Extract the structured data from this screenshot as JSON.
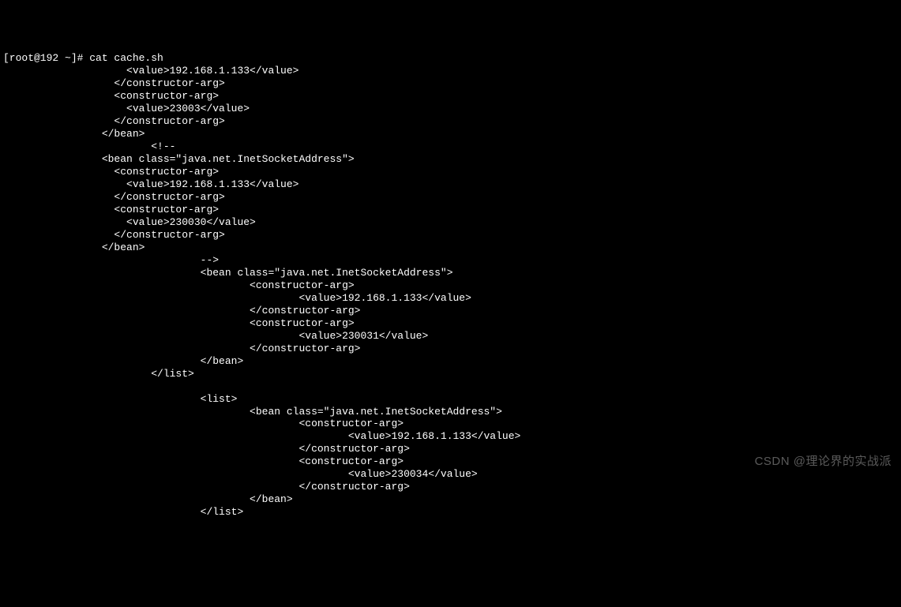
{
  "terminal": {
    "lines": [
      "[root@192 ~]# cat cache.sh",
      "                    <value>192.168.1.133</value>",
      "                  </constructor-arg>",
      "                  <constructor-arg>",
      "                    <value>23003</value>",
      "                  </constructor-arg>",
      "                </bean>",
      "                        <!--",
      "                <bean class=\"java.net.InetSocketAddress\">",
      "                  <constructor-arg>",
      "                    <value>192.168.1.133</value>",
      "                  </constructor-arg>",
      "                  <constructor-arg>",
      "                    <value>230030</value>",
      "                  </constructor-arg>",
      "                </bean>",
      "                                -->",
      "                                <bean class=\"java.net.InetSocketAddress\">",
      "                                        <constructor-arg>",
      "                                                <value>192.168.1.133</value>",
      "                                        </constructor-arg>",
      "                                        <constructor-arg>",
      "                                                <value>230031</value>",
      "                                        </constructor-arg>",
      "                                </bean>",
      "                        </list>",
      "",
      "                                <list>",
      "                                        <bean class=\"java.net.InetSocketAddress\">",
      "                                                <constructor-arg>",
      "                                                        <value>192.168.1.133</value>",
      "                                                </constructor-arg>",
      "                                                <constructor-arg>",
      "                                                        <value>230034</value>",
      "                                                </constructor-arg>",
      "                                        </bean>",
      "                                </list>"
    ]
  },
  "watermark": {
    "text": "CSDN @理论界的实战派"
  }
}
